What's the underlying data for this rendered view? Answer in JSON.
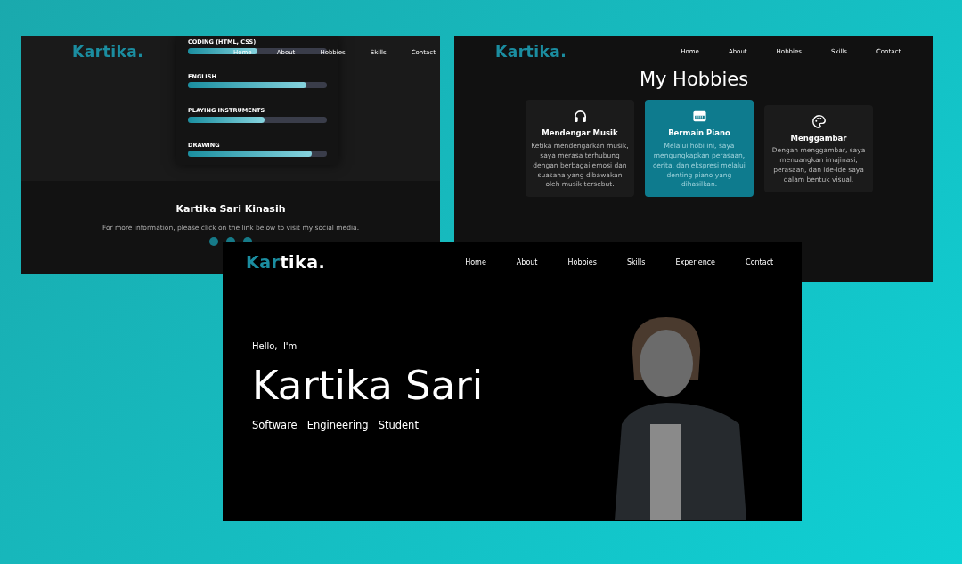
{
  "skills_page": {
    "logo": [
      {
        "text": "Kartika.",
        "accent": true
      }
    ],
    "nav": [
      "Home",
      "About",
      "Hobbies",
      "Skills",
      "Contact"
    ],
    "skills": [
      {
        "name": "CODING (HTML, CSS)",
        "level": 0.5
      },
      {
        "name": "ENGLISH",
        "level": 0.85
      },
      {
        "name": "PLAYING INSTRUMENTS",
        "level": 0.55
      },
      {
        "name": "DRAWING",
        "level": 0.89
      }
    ],
    "footer": {
      "name": "Kartika Sari Kinasih",
      "text": "For more information, please click on the link below to visit my social media."
    }
  },
  "hobbies_page": {
    "logo": [
      {
        "text": "Kartika.",
        "accent": true
      }
    ],
    "nav": [
      "Home",
      "About",
      "Hobbies",
      "Skills",
      "Contact"
    ],
    "title": "My Hobbies",
    "hobbies": [
      {
        "kind": "headphones",
        "title": "Mendengar Musik",
        "text": "Ketika mendengarkan musik, saya merasa terhubung dengan berbagai emosi dan suasana yang dibawakan oleh musik tersebut.",
        "highlighted": false
      },
      {
        "kind": "piano",
        "title": "Bermain Piano",
        "text": "Melalui hobi ini, saya mengungkapkan perasaan, cerita, dan ekspresi melalui denting piano yang dihasilkan.",
        "highlighted": true
      },
      {
        "kind": "palette",
        "title": "Menggambar",
        "text": "Dengan menggambar, saya menuangkan imajinasi, perasaan, dan ide-ide saya dalam bentuk visual.",
        "highlighted": false
      }
    ]
  },
  "home_page": {
    "logo": [
      {
        "text": "Kar",
        "accent": true
      },
      {
        "text": "tika.",
        "accent": false
      }
    ],
    "nav": [
      "Home",
      "About",
      "Hobbies",
      "Skills",
      "Experience",
      "Contact"
    ],
    "greeting": "Hello,  I'm",
    "name": "Kartika Sari",
    "subtitle": "Software   Engineering   Student"
  }
}
